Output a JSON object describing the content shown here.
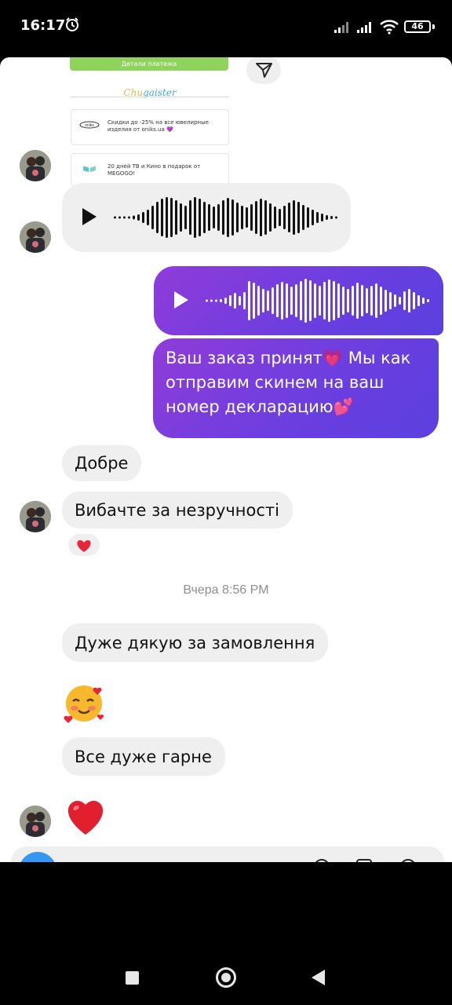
{
  "status_bar": {
    "time": "16:17",
    "battery": "46",
    "icons": [
      "alarm-icon",
      "signal-icon",
      "signal-icon",
      "wifi-icon",
      "battery-icon"
    ]
  },
  "shared_card": {
    "payment_details": "Детали платежа",
    "brand_a": "Chu",
    "brand_b": "gaister",
    "ad1": "Скидки до -25% на все ювелирные изделия от oniks.ua 💜",
    "ad1_brand": "oniks",
    "ad2": "20 дней ТВ и Кино в подарок от MEGOGO!"
  },
  "messages": {
    "outgoing_text": "Ваш заказ принят💗 Мы как отправим скинем на ваш номер декларацию💕",
    "dobre": "Добре",
    "vybachte": "Вибачте за незручності",
    "reaction": "❤️",
    "timestamp": "Вчера 8:56 PM",
    "duzhe": "Дуже дякую за замовлення",
    "emoji_smile": "🥰",
    "vse": "Все дуже гарне",
    "emoji_heart": "❤️"
  },
  "colors": {
    "incoming_bubble": "#efefef",
    "outgoing_start": "#8f3cd9",
    "outgoing_end": "#5b40df",
    "accent": "#3797f0"
  }
}
